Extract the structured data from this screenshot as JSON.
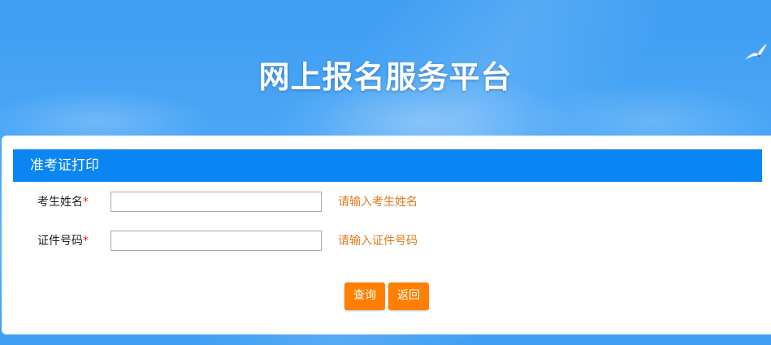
{
  "header": {
    "site_title": "网上报名服务平台"
  },
  "panel": {
    "title": "准考证打印"
  },
  "form": {
    "name_field": {
      "label": "考生姓名",
      "required_mark": "*",
      "value": "",
      "hint": "请输入考生姓名"
    },
    "id_field": {
      "label": "证件号码",
      "required_mark": "*",
      "value": "",
      "hint": "请输入证件号码"
    }
  },
  "buttons": {
    "search_label": "查询",
    "back_label": "返回"
  },
  "colors": {
    "header_bar": "#0a85f4",
    "button": "#ff7f00",
    "hint_text": "#e07a18",
    "required": "#e02020"
  },
  "icons": {
    "background_decoration": "seagull-icon"
  }
}
